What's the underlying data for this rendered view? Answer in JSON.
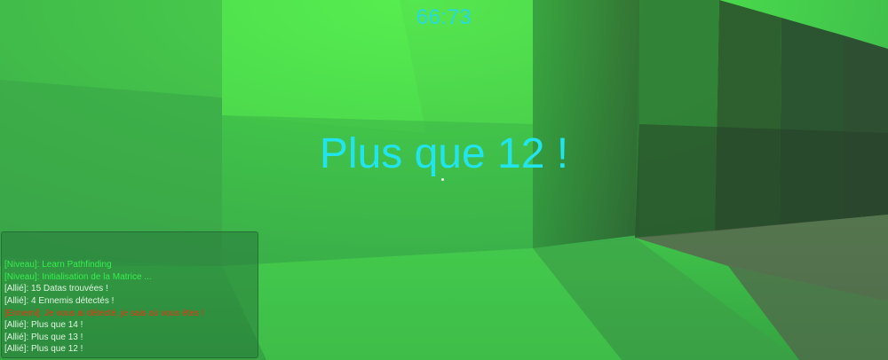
{
  "hud": {
    "timer": "66:73",
    "center_message": "Plus que 12 !"
  },
  "chat": {
    "lines": [
      {
        "text": "[Niveau]: Learn Pathfinding",
        "color": "green"
      },
      {
        "text": "[Niveau]: Initialisation de la Matrice ...",
        "color": "green"
      },
      {
        "text": "[Allié]: 15 Datas trouvées !",
        "color": "white"
      },
      {
        "text": "[Allié]: 4 Ennemis détectés !",
        "color": "white"
      },
      {
        "text": "[Ennemi]: Je vous ai détecté, je sais où vous êtes !",
        "color": "red"
      },
      {
        "text": "[Allié]: Plus que 14 !",
        "color": "white"
      },
      {
        "text": "[Allié]: Plus que 13 !",
        "color": "white"
      },
      {
        "text": "[Allié]: Plus que 12 !",
        "color": "white"
      }
    ]
  },
  "colors": {
    "hud_text": "#22e4ee",
    "level_text": "#36f04e",
    "ally_text": "#dff5e2",
    "enemy_text": "#e8340e",
    "world_green": "#3fb84a"
  }
}
